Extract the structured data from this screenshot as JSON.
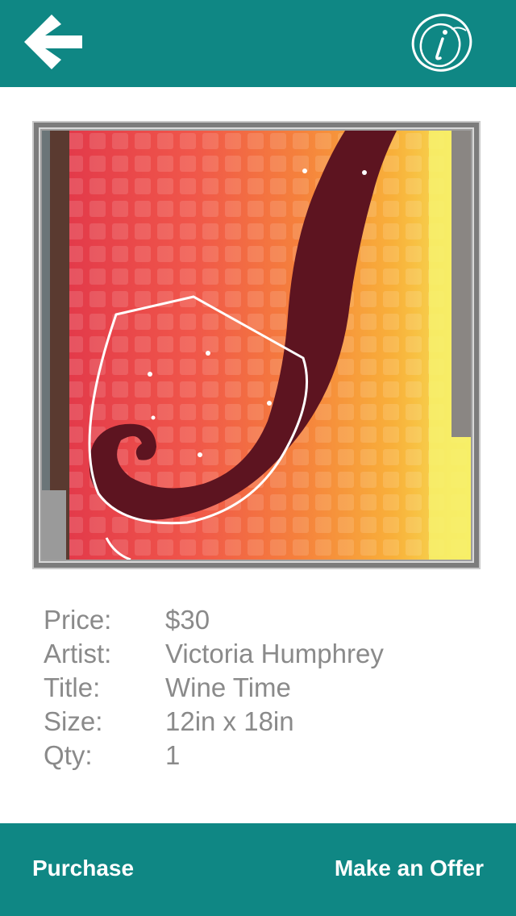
{
  "header": {
    "back_icon": "back-arrow-icon",
    "info_icon": "info-icon",
    "bg_color": "#0f8784"
  },
  "artwork": {
    "image_description_icon": "painting-wine-glass-image"
  },
  "details": {
    "rows": [
      {
        "label": "Price:",
        "value": "$30"
      },
      {
        "label": "Artist:",
        "value": "Victoria Humphrey"
      },
      {
        "label": "Title:",
        "value": "Wine Time"
      },
      {
        "label": "Size:",
        "value": "12in x 18in"
      },
      {
        "label": "Qty:",
        "value": "1"
      }
    ]
  },
  "footer": {
    "purchase_label": "Purchase",
    "offer_label": "Make an Offer"
  }
}
